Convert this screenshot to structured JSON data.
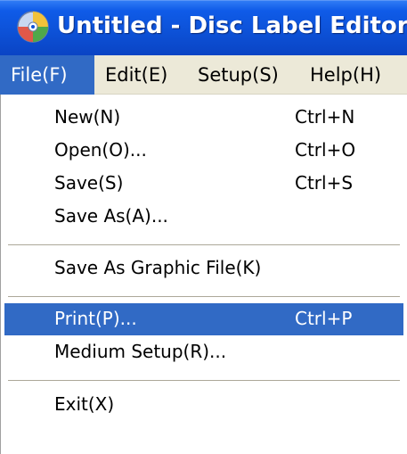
{
  "window": {
    "title": "Untitled - Disc Label Editor",
    "icon": "disc-label-app-icon"
  },
  "menubar": {
    "items": [
      {
        "label": "File(F)",
        "active": true
      },
      {
        "label": "Edit(E)",
        "active": false
      },
      {
        "label": "Setup(S)",
        "active": false
      },
      {
        "label": "Help(H)",
        "active": false
      }
    ]
  },
  "file_menu": {
    "items": [
      {
        "label": "New(N)",
        "shortcut": "Ctrl+N"
      },
      {
        "label": "Open(O)...",
        "shortcut": "Ctrl+O"
      },
      {
        "label": "Save(S)",
        "shortcut": "Ctrl+S"
      },
      {
        "label": "Save As(A)...",
        "shortcut": ""
      },
      {
        "label": "Save As Graphic File(K)",
        "shortcut": ""
      },
      {
        "label": "Print(P)...",
        "shortcut": "Ctrl+P",
        "highlighted": true
      },
      {
        "label": "Medium Setup(R)...",
        "shortcut": ""
      },
      {
        "label": "Exit(X)",
        "shortcut": ""
      }
    ]
  },
  "colors": {
    "titlebar": "#0d52d8",
    "highlight": "#316ac5",
    "menubar_bg": "#ece9d8",
    "menu_bg": "#ffffff"
  }
}
